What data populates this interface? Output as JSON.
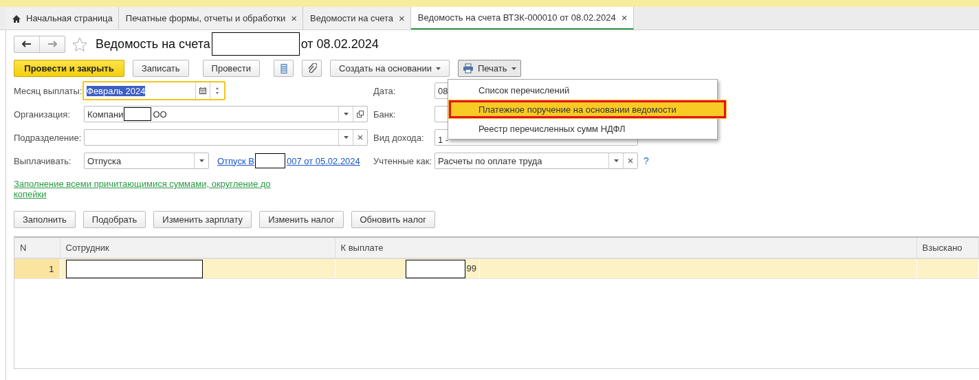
{
  "tabs": [
    {
      "label": "Начальная страница",
      "selected": false,
      "kind": "home"
    },
    {
      "label": "Печатные формы, отчеты и обработки",
      "selected": false,
      "close": "×",
      "kind": "tab"
    },
    {
      "label": "Ведомости на счета",
      "selected": false,
      "close": "×",
      "kind": "tab"
    },
    {
      "label": "Ведомость на счета ВТЗК-000010 от 08.02.2024",
      "selected": true,
      "close": "×",
      "kind": "tab"
    }
  ],
  "header": {
    "title_before": "Ведомость на счета",
    "title_after": "от 08.02.2024",
    "favorite": false
  },
  "toolbar": [
    {
      "kind": "primary",
      "label": "Провести и закрыть"
    },
    {
      "kind": "button",
      "label": "Записать"
    },
    {
      "kind": "button",
      "label": "Провести"
    },
    {
      "kind": "list"
    },
    {
      "kind": "attach"
    },
    {
      "kind": "dropdown",
      "label": "Создать на основании"
    },
    {
      "kind": "print",
      "label": "Печать",
      "expanded": true
    }
  ],
  "print_menu": [
    {
      "label": "Список перечислений",
      "selected": false,
      "outlined": false
    },
    {
      "label": "Платежное поручение на основании ведомости",
      "selected": true,
      "outlined": true
    },
    {
      "label": "Реестр перечисленных сумм НДФЛ",
      "selected": false,
      "outlined": false
    }
  ],
  "fields_left": [
    {
      "kind": "month",
      "label": "Месяц выплаты:",
      "value": "Февраль 2024",
      "focused": true
    },
    {
      "kind": "open",
      "label": "Организация:",
      "value": "Компани",
      "value_after": "ОО",
      "focused": false
    },
    {
      "kind": "clear",
      "label": "Подразделение:",
      "focused": false
    },
    {
      "kind": "dropdown",
      "label": "Выплачивать:",
      "value": "Отпуска",
      "link_before": "Отпуск В",
      "link_after": "007 от 05.02.2024",
      "focused": false
    }
  ],
  "fields_right": [
    {
      "kind": "plain",
      "label": "Дата:",
      "value": "08"
    },
    {
      "kind": "plain",
      "label": "Банк:"
    },
    {
      "kind": "plain",
      "label": "Вид дохода:",
      "value": "1 -"
    },
    {
      "kind": "clear",
      "label": "Учтенные как:",
      "value": "Расчеты по оплате труда",
      "help": "?"
    }
  ],
  "fill_link": "Заполнение всеми причитающимися суммами, округление до копейки",
  "table_buttons": [
    "Заполнить",
    "Подобрать",
    "Изменить зарплату",
    "Изменить налог",
    "Обновить налог"
  ],
  "table": {
    "columns": [
      "N",
      "Сотрудник",
      "К выплате",
      "Взыскано"
    ],
    "rows": [
      {
        "n": "1",
        "amount_after": "99",
        "selected": true
      }
    ]
  }
}
